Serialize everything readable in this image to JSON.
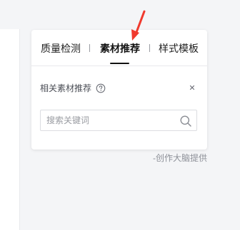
{
  "tabs": [
    {
      "label": "质量检测"
    },
    {
      "label": "素材推荐"
    },
    {
      "label": "样式模板"
    }
  ],
  "active_tab_index": 1,
  "section": {
    "title": "相关素材推荐",
    "help_icon": "question-circle-icon",
    "close_icon": "close-icon"
  },
  "search": {
    "placeholder": "搜索关键词",
    "value": "",
    "icon": "search-icon"
  },
  "footer": {
    "credit": "-创作大脑提供"
  },
  "annotation": {
    "arrow_color": "#f03a2e"
  },
  "colors": {
    "active_tab": "#111111",
    "text_secondary": "#4a4d55",
    "placeholder": "#9a9ca2",
    "background": "#f4f5f7"
  }
}
